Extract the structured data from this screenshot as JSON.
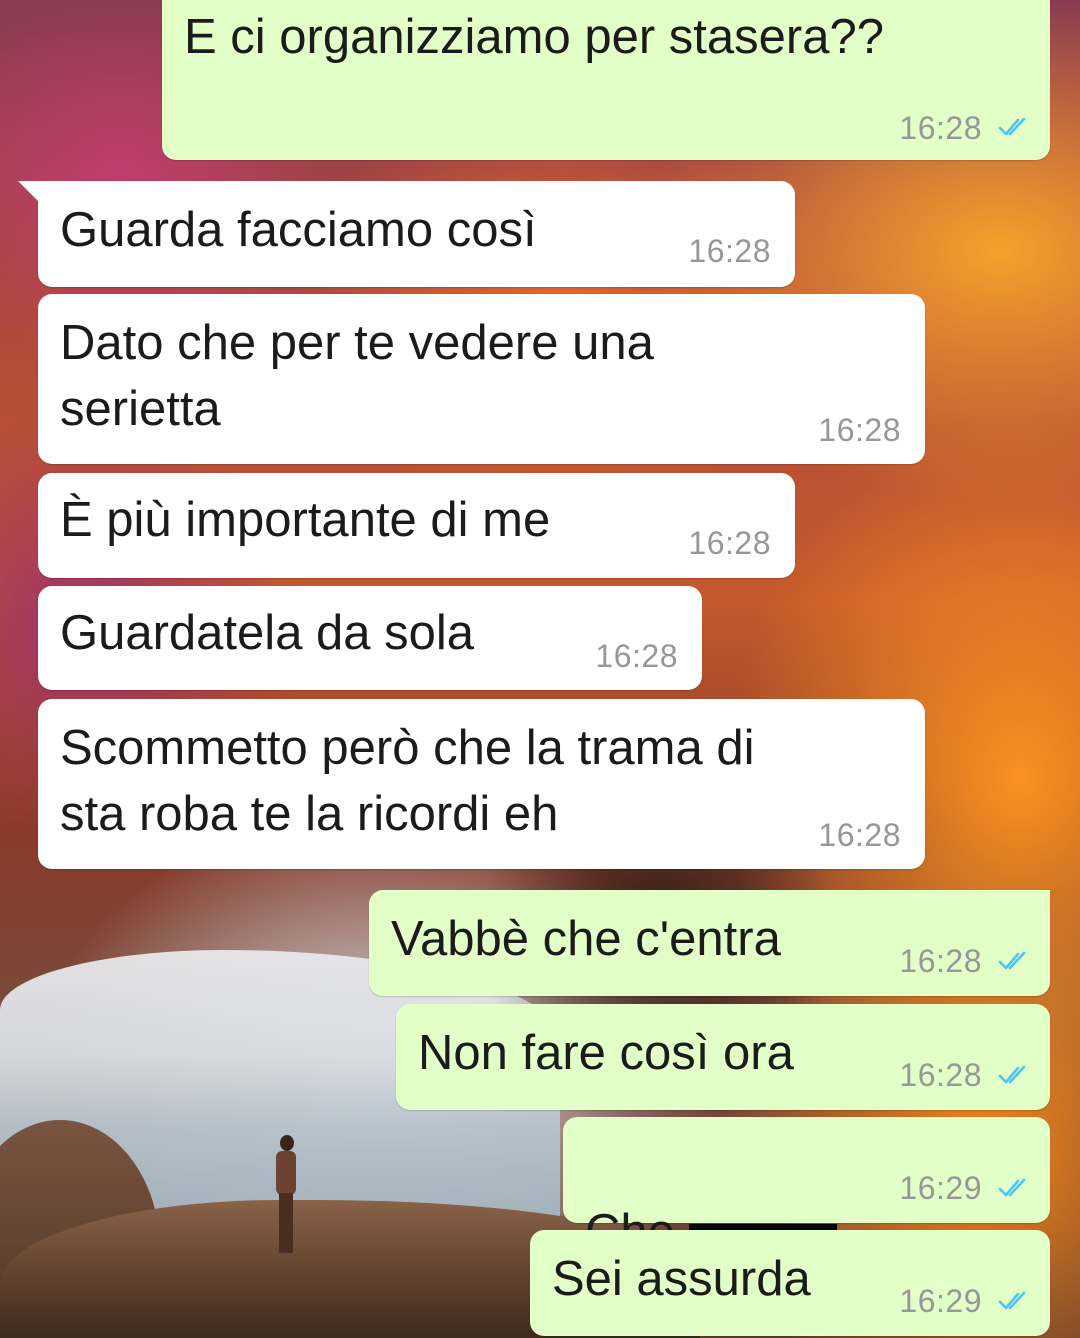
{
  "messages": [
    {
      "id": 1,
      "direction": "outgoing",
      "text": "E ci organizziamo per stasera??",
      "time": "16:28",
      "read": true
    },
    {
      "id": 2,
      "direction": "incoming",
      "text": "Guarda facciamo così",
      "time": "16:28"
    },
    {
      "id": 3,
      "direction": "incoming",
      "text": "Dato che per te vedere una\nserietta",
      "time": "16:28"
    },
    {
      "id": 4,
      "direction": "incoming",
      "text": "È più importante di me",
      "time": "16:28"
    },
    {
      "id": 5,
      "direction": "incoming",
      "text": "Guardatela da sola",
      "time": "16:28"
    },
    {
      "id": 6,
      "direction": "incoming",
      "text": "Scommetto però che la trama di\nsta roba te la ricordi eh",
      "time": "16:28"
    },
    {
      "id": 7,
      "direction": "outgoing",
      "text": "Vabbè che c'entra",
      "time": "16:28",
      "read": true
    },
    {
      "id": 8,
      "direction": "outgoing",
      "text": "Non fare così ora",
      "time": "16:28",
      "read": true
    },
    {
      "id": 9,
      "direction": "outgoing",
      "text": "Che",
      "time": "16:29",
      "read": true,
      "redacted": true
    },
    {
      "id": 10,
      "direction": "outgoing",
      "text": "Sei assurda",
      "time": "16:29",
      "read": true
    }
  ],
  "colors": {
    "incoming_bubble": "#ffffff",
    "outgoing_bubble": "#e1ffc7",
    "read_ticks": "#4fc3f7",
    "timestamp": "#979797"
  },
  "icons": {
    "read_receipt": "double-check-icon"
  }
}
